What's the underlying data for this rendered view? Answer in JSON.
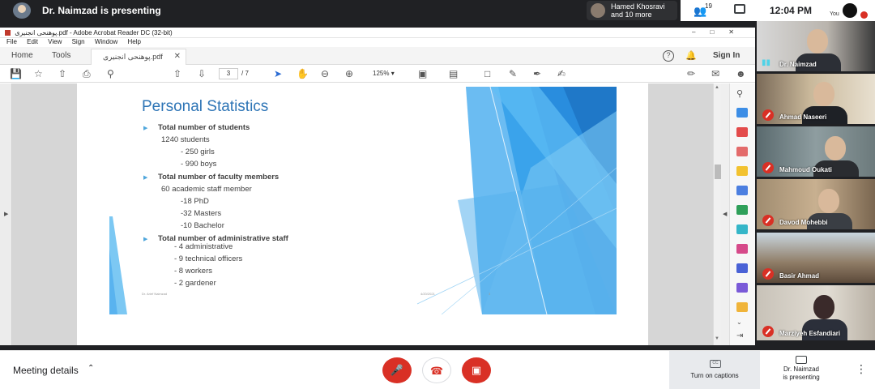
{
  "meet_top": {
    "presenting_text": "Dr. Naimzad is presenting",
    "participants_pill": "Hamed Khosravi and 10 more",
    "people_count": "19",
    "clock": "12:04 PM",
    "self_label": "You"
  },
  "acrobat": {
    "window_title": "پوهنحی انجنیری.pdf - Adobe Acrobat Reader DC (32-bit)",
    "menu": [
      "File",
      "Edit",
      "View",
      "Sign",
      "Window",
      "Help"
    ],
    "tab_home": "Home",
    "tab_tools": "Tools",
    "tab_document": "پوهنحی انجنیری.pdf",
    "sign_in": "Sign In",
    "page_current": "3",
    "page_total": "/ 7",
    "zoom": "125%"
  },
  "slide": {
    "title": "Personal Statistics",
    "lines": [
      {
        "text": "Total number of students",
        "bullet": true
      },
      {
        "text": "1240 students",
        "bullet": false
      },
      {
        "text": "- 250 girls",
        "bullet": false
      },
      {
        "text": "- 990 boys",
        "bullet": false
      },
      {
        "text": "Total number of faculty members",
        "bullet": true
      },
      {
        "text": "60 academic staff member",
        "bullet": false
      },
      {
        "text": "-18 PhD",
        "bullet": false
      },
      {
        "text": "-32 Masters",
        "bullet": false
      },
      {
        "text": "-10 Bachelor",
        "bullet": false
      },
      {
        "text": "Total number of administrative staff",
        "bullet": true
      },
      {
        "text": "- 4 administrative",
        "bullet": false
      },
      {
        "text": "- 9 technical officers",
        "bullet": false
      },
      {
        "text": "- 8 workers",
        "bullet": false
      },
      {
        "text": "- 2 gardener",
        "bullet": false
      }
    ],
    "footer_author": "Dr. Arief Naimzad",
    "footer_date": "4/20/2021",
    "footer_page": "3"
  },
  "participants": [
    {
      "name": "Dr. Naimzad",
      "muted": false
    },
    {
      "name": "Ahmad Naseeri",
      "muted": true
    },
    {
      "name": "Mahmoud Oukati",
      "muted": true
    },
    {
      "name": "Davod Mohebbi",
      "muted": true
    },
    {
      "name": "Basir Ahmad",
      "muted": true
    },
    {
      "name": "Marziyeh Esfandiari",
      "muted": true
    }
  ],
  "meet_bottom": {
    "meeting_details": "Meeting details",
    "captions": "Turn on captions",
    "presenting_line1": "Dr. Naimzad",
    "presenting_line2": "is presenting"
  },
  "colors": {
    "accent_blue": "#2e75b6",
    "meet_red": "#d93025",
    "meet_dark": "#202124"
  }
}
